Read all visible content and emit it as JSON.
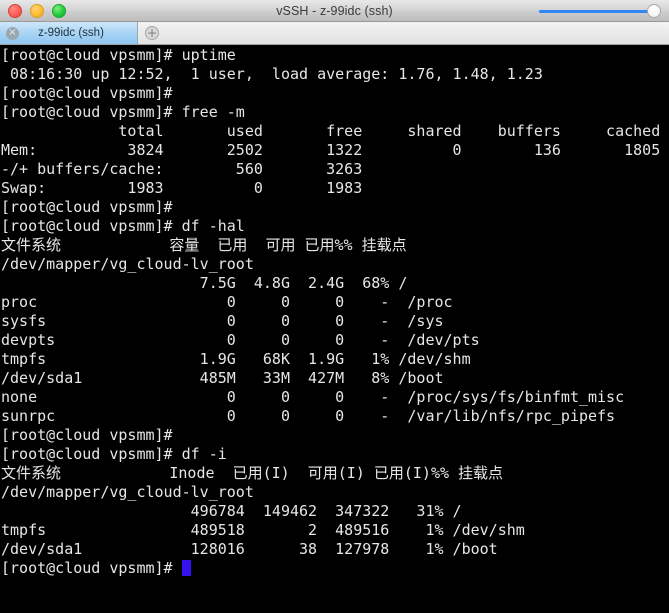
{
  "window": {
    "title": "vSSH - z-99idc (ssh)",
    "traffic_lights": [
      {
        "name": "close",
        "color": "#ff5f57"
      },
      {
        "name": "minimize",
        "color": "#ffbd2e"
      },
      {
        "name": "maximize",
        "color": "#28c940"
      }
    ],
    "slider": {
      "accent_color": "#2f87f2",
      "value": "100"
    }
  },
  "tabbar": {
    "tab_label": "z-99idc (ssh)",
    "close_glyph": "×",
    "new_tab_glyph": "+"
  },
  "terminal": {
    "background": "#000000",
    "foreground": "#e6e6e6",
    "cursor_color": "#3512ef",
    "prompt": "[root@cloud vpsmm]#",
    "lines": [
      "[root@cloud vpsmm]# uptime",
      " 08:16:30 up 12:52,  1 user,  load average: 1.76, 1.48, 1.23",
      "[root@cloud vpsmm]#",
      "[root@cloud vpsmm]# free -m",
      "             total       used       free     shared    buffers     cached",
      "Mem:          3824       2502       1322          0        136       1805",
      "-/+ buffers/cache:        560       3263",
      "Swap:         1983          0       1983",
      "[root@cloud vpsmm]#",
      "[root@cloud vpsmm]# df -hal",
      "文件系统            容量  已用  可用 已用%% 挂载点",
      "/dev/mapper/vg_cloud-lv_root",
      "                      7.5G  4.8G  2.4G  68% /",
      "proc                     0     0     0    -  /proc",
      "sysfs                    0     0     0    -  /sys",
      "devpts                   0     0     0    -  /dev/pts",
      "tmpfs                 1.9G   68K  1.9G   1% /dev/shm",
      "/dev/sda1             485M   33M  427M   8% /boot",
      "none                     0     0     0    -  /proc/sys/fs/binfmt_misc",
      "sunrpc                   0     0     0    -  /var/lib/nfs/rpc_pipefs",
      "[root@cloud vpsmm]#",
      "[root@cloud vpsmm]# df -i",
      "文件系统            Inode  已用(I)  可用(I) 已用(I)%% 挂载点",
      "/dev/mapper/vg_cloud-lv_root",
      "                     496784  149462  347322   31% /",
      "tmpfs                489518       2  489516    1% /dev/shm",
      "/dev/sda1            128016      38  127978    1% /boot"
    ],
    "last_line": "[root@cloud vpsmm]# ",
    "commands": [
      "uptime",
      "free -m",
      "df -hal",
      "df -i"
    ],
    "uptime": {
      "time": "08:16:30",
      "up": "12:52",
      "users": "1 user",
      "load_average": [
        "1.76",
        "1.48",
        "1.23"
      ]
    },
    "free": {
      "headers": [
        "total",
        "used",
        "free",
        "shared",
        "buffers",
        "cached"
      ],
      "rows": [
        {
          "label": "Mem:",
          "values": [
            "3824",
            "2502",
            "1322",
            "0",
            "136",
            "1805"
          ]
        },
        {
          "label": "-/+ buffers/cache:",
          "values": [
            "560",
            "3263"
          ]
        },
        {
          "label": "Swap:",
          "values": [
            "1983",
            "0",
            "1983"
          ]
        }
      ]
    },
    "df_hal": {
      "headers": [
        "文件系统",
        "容量",
        "已用",
        "可用",
        "已用%%",
        "挂载点"
      ],
      "rows": [
        {
          "fs": "/dev/mapper/vg_cloud-lv_root",
          "size": "7.5G",
          "used": "4.8G",
          "avail": "2.4G",
          "pct": "68%",
          "mount": "/"
        },
        {
          "fs": "proc",
          "size": "0",
          "used": "0",
          "avail": "0",
          "pct": "-",
          "mount": "/proc"
        },
        {
          "fs": "sysfs",
          "size": "0",
          "used": "0",
          "avail": "0",
          "pct": "-",
          "mount": "/sys"
        },
        {
          "fs": "devpts",
          "size": "0",
          "used": "0",
          "avail": "0",
          "pct": "-",
          "mount": "/dev/pts"
        },
        {
          "fs": "tmpfs",
          "size": "1.9G",
          "used": "68K",
          "avail": "1.9G",
          "pct": "1%",
          "mount": "/dev/shm"
        },
        {
          "fs": "/dev/sda1",
          "size": "485M",
          "used": "33M",
          "avail": "427M",
          "pct": "8%",
          "mount": "/boot"
        },
        {
          "fs": "none",
          "size": "0",
          "used": "0",
          "avail": "0",
          "pct": "-",
          "mount": "/proc/sys/fs/binfmt_misc"
        },
        {
          "fs": "sunrpc",
          "size": "0",
          "used": "0",
          "avail": "0",
          "pct": "-",
          "mount": "/var/lib/nfs/rpc_pipefs"
        }
      ]
    },
    "df_i": {
      "headers": [
        "文件系统",
        "Inode",
        "已用(I)",
        "可用(I)",
        "已用(I)%%",
        "挂载点"
      ],
      "rows": [
        {
          "fs": "/dev/mapper/vg_cloud-lv_root",
          "inode": "496784",
          "iused": "149462",
          "ifree": "347322",
          "pct": "31%",
          "mount": "/"
        },
        {
          "fs": "tmpfs",
          "inode": "489518",
          "iused": "2",
          "ifree": "489516",
          "pct": "1%",
          "mount": "/dev/shm"
        },
        {
          "fs": "/dev/sda1",
          "inode": "128016",
          "iused": "38",
          "ifree": "127978",
          "pct": "1%",
          "mount": "/boot"
        }
      ]
    }
  }
}
